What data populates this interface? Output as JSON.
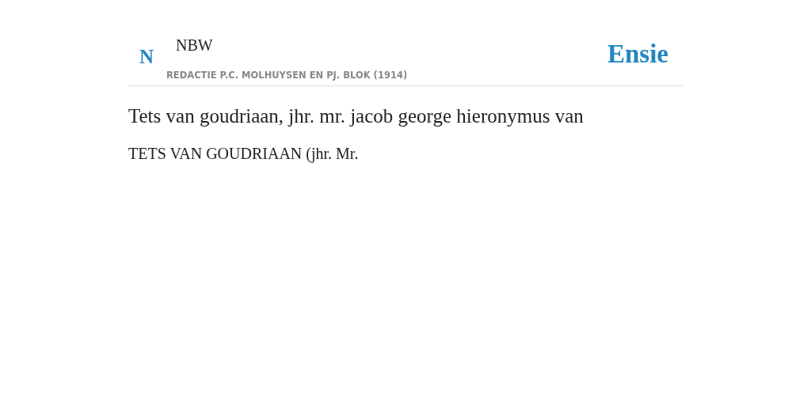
{
  "header": {
    "logo_letter": "N",
    "source": "NBW",
    "subtitle": "REDACTIE P.C. MOLHUYSEN EN PJ. BLOK (1914)",
    "brand": "Ensie"
  },
  "article": {
    "title": "Tets van goudriaan, jhr. mr. jacob george hieronymus van",
    "body": "TETS VAN GOUDRIAAN (jhr. Mr."
  }
}
